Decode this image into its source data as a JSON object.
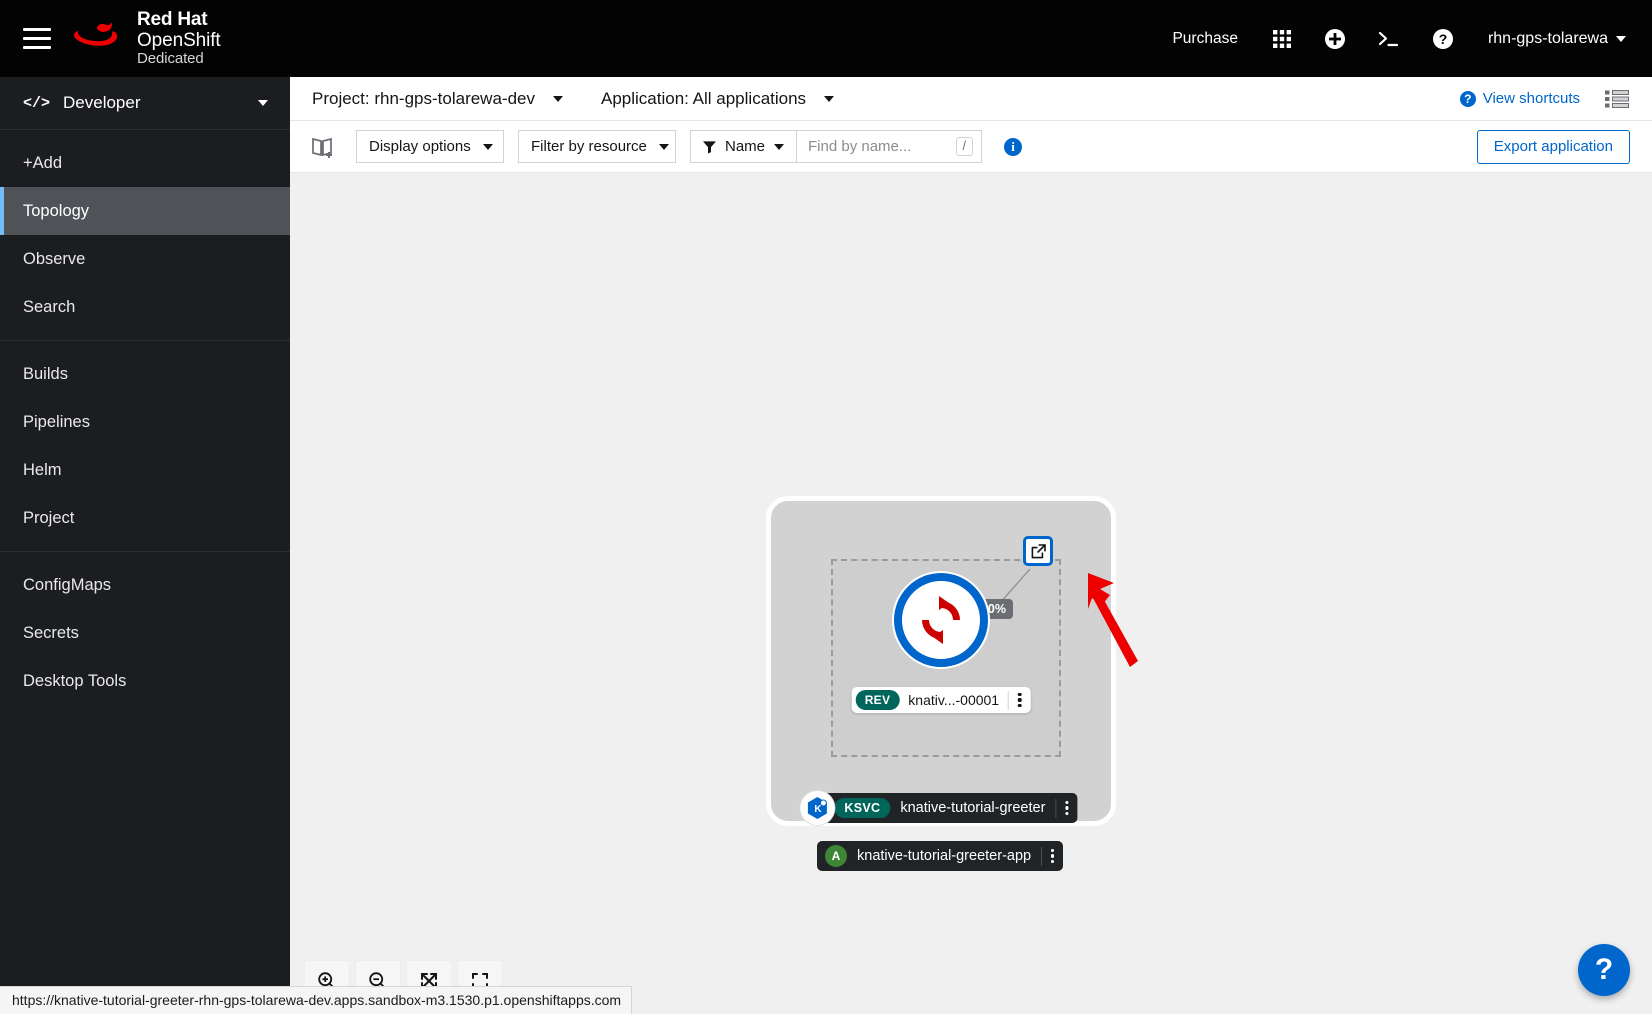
{
  "masthead": {
    "menu_icon": "hamburger-icon",
    "brand": {
      "line1": "Red Hat",
      "line2": "OpenShift",
      "line3": "Dedicated"
    },
    "purchase_label": "Purchase",
    "apps_icon": "grid-apps-icon",
    "plus_icon": "plus-circle-icon",
    "terminal_icon": "terminal-icon",
    "help_icon": "help-circle-icon",
    "user": "rhn-gps-tolarewa"
  },
  "sidebar": {
    "perspective": {
      "label": "Developer",
      "icon": "code-brackets-icon"
    },
    "sections": [
      {
        "items": [
          {
            "label": "+Add",
            "name": "add",
            "active": false
          },
          {
            "label": "Topology",
            "name": "topology",
            "active": true
          },
          {
            "label": "Observe",
            "name": "observe",
            "active": false
          },
          {
            "label": "Search",
            "name": "search",
            "active": false
          }
        ]
      },
      {
        "items": [
          {
            "label": "Builds",
            "name": "builds",
            "active": false
          },
          {
            "label": "Pipelines",
            "name": "pipelines",
            "active": false
          },
          {
            "label": "Helm",
            "name": "helm",
            "active": false
          },
          {
            "label": "Project",
            "name": "project",
            "active": false
          }
        ]
      },
      {
        "items": [
          {
            "label": "ConfigMaps",
            "name": "configmaps",
            "active": false
          },
          {
            "label": "Secrets",
            "name": "secrets",
            "active": false
          },
          {
            "label": "Desktop Tools",
            "name": "desktop-tools",
            "active": false
          }
        ]
      }
    ]
  },
  "project_bar": {
    "project": "Project: rhn-gps-tolarewa-dev",
    "application": "Application: All applications",
    "view_shortcuts": "View shortcuts",
    "list_view_icon": "list-view-icon"
  },
  "filter_bar": {
    "quick_starts_icon": "book-plus-icon",
    "display_options": "Display options",
    "filter_by_resource": "Filter by resource",
    "name_filter": "Name",
    "filter_icon": "funnel-icon",
    "search_value": "",
    "search_placeholder": "Find by name...",
    "search_shortcut": "/",
    "info_icon": "info-circle-icon",
    "export_application": "Export application"
  },
  "topology": {
    "service_node": {
      "kind_badge": "KSVC",
      "name": "knative-tutorial-greeter",
      "avatar_icon": "knative-icon",
      "kebab_icon": "kebab-menu-icon",
      "external_link_icon": "external-link-icon"
    },
    "revision": {
      "kind_badge": "REV",
      "name": "knativ...-00001",
      "traffic": "100%"
    },
    "application_group": {
      "initial": "A",
      "name": "knative-tutorial-greeter-app"
    }
  },
  "zoom_controls": [
    {
      "name": "zoom-in",
      "icon": "zoom-in-icon"
    },
    {
      "name": "zoom-out",
      "icon": "zoom-out-icon"
    },
    {
      "name": "fit-to-screen",
      "icon": "fit-to-screen-icon"
    },
    {
      "name": "reset-view",
      "icon": "expand-icon"
    }
  ],
  "help_fab": {
    "label": "?",
    "name": "help-fab"
  },
  "status_bar": {
    "url": "https://knative-tutorial-greeter-rhn-gps-tolarewa-dev.apps.sandbox-m3.1530.p1.openshiftapps.com"
  },
  "colors": {
    "brand_red": "#ee0000",
    "accent_blue": "#06c",
    "knative_blue": "#0066cc",
    "badge_teal": "#00655b",
    "app_green": "#3e8635",
    "arrow_red": "#ee0000"
  }
}
